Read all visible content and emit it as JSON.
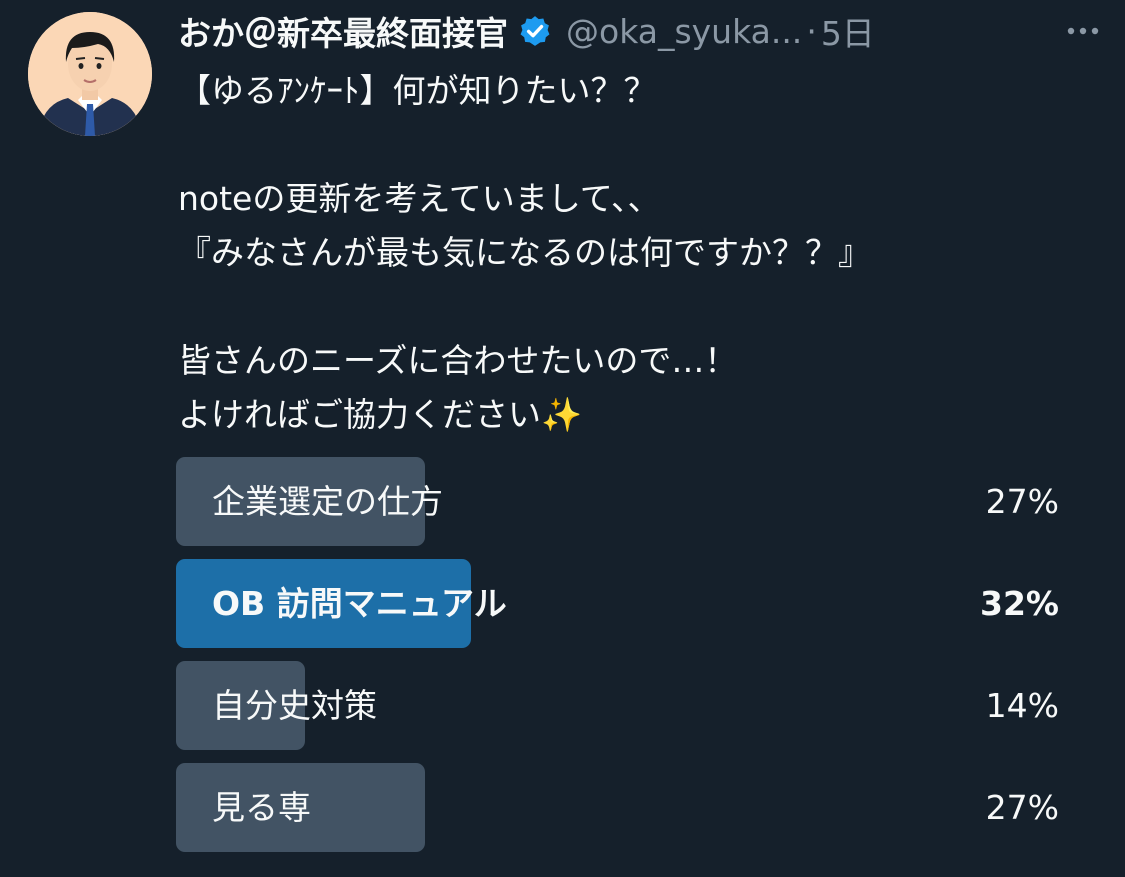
{
  "user": {
    "display_name": "おか＠新卒最終面接官",
    "handle": "@oka_syuka...",
    "separator": "·",
    "time": "5日",
    "avatar_icon": "man-in-suit-avatar",
    "verified_icon": "verified-badge-icon",
    "more_icon": "more-dots-icon"
  },
  "tweet": {
    "lines": [
      "【ゆるｱﾝｹｰﾄ】何が知りたい？？",
      "",
      "noteの更新を考えていまして、、",
      "『みなさんが最も気になるのは何ですか？？』",
      "",
      "皆さんのニーズに合わせたいので…！",
      "よければご協力ください"
    ],
    "emoji": "✨"
  },
  "poll": {
    "options": [
      {
        "label": "企業選定の仕方",
        "percent_label": "27%",
        "percent": 27,
        "winner": false
      },
      {
        "label": "OB 訪問マニュアル",
        "percent_label": "32%",
        "percent": 32,
        "winner": true
      },
      {
        "label": "自分史対策",
        "percent_label": "14%",
        "percent": 14,
        "winner": false
      },
      {
        "label": "見る専",
        "percent_label": "27%",
        "percent": 27,
        "winner": false
      }
    ]
  },
  "colors": {
    "background": "#15202b",
    "text": "#f7f9f9",
    "muted": "#8b98a5",
    "poll_bar": "#425364",
    "poll_bar_winner": "#1d6fa8",
    "verified": "#1d9bf0"
  }
}
